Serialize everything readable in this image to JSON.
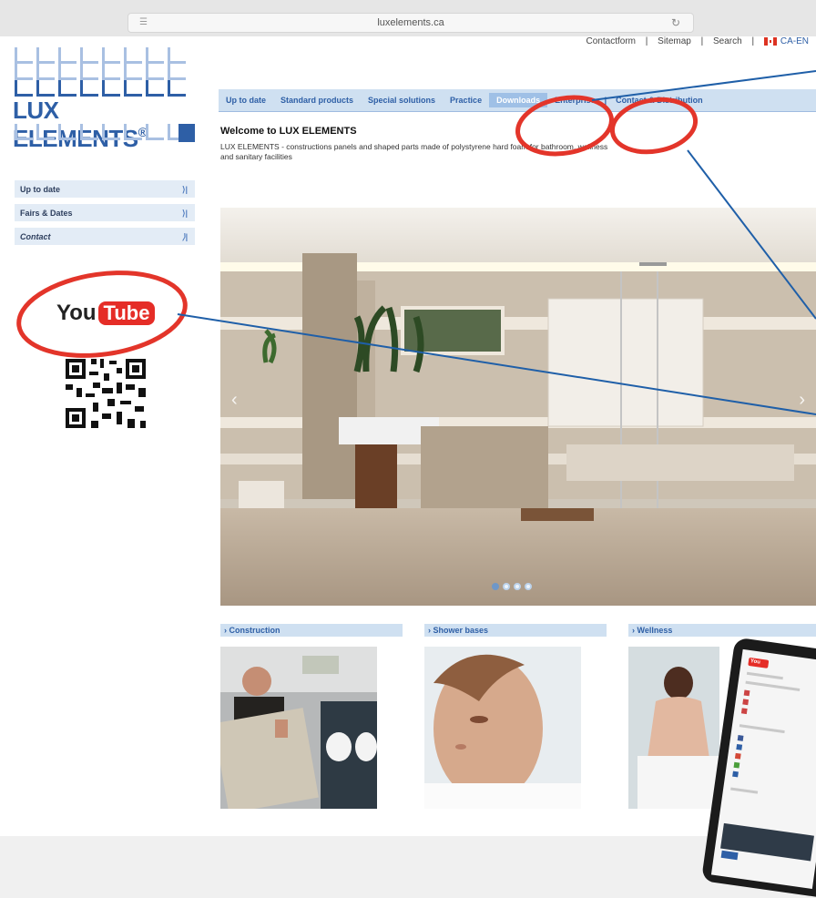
{
  "browser": {
    "url": "luxelements.ca",
    "reader_icon": "reader-icon",
    "reload_icon": "reload-icon"
  },
  "logo": {
    "text": "LUX ELEMENTS",
    "registered": "®"
  },
  "toplinks": {
    "contactform": "Contactform",
    "sitemap": "Sitemap",
    "search": "Search",
    "separator": "|",
    "locale": "CA-EN",
    "flag_icon": "canada-flag-icon"
  },
  "mainnav": {
    "items": [
      "Up to date",
      "Standard products",
      "Special solutions",
      "Practice",
      "Downloads",
      "Enterprise",
      "Contact & Distribution"
    ],
    "separator": "|"
  },
  "sidebar": {
    "items": [
      {
        "label": "Up to date",
        "chevron": "⟩|"
      },
      {
        "label": "Fairs & Dates",
        "chevron": "⟩|"
      },
      {
        "label": "Contact",
        "chevron": "⟩|"
      }
    ]
  },
  "youtube": {
    "you": "You",
    "tube": "Tube"
  },
  "content": {
    "welcome": "Welcome to LUX ELEMENTS",
    "intro": "LUX ELEMENTS - constructions panels and shaped parts made of polystyrene hard foam for bathroom, wellness and sanitary facilities",
    "slider_active": 1,
    "slider_count": 4,
    "prev_arrow": "‹",
    "next_arrow": "›"
  },
  "categories": [
    {
      "label": "› Construction"
    },
    {
      "label": "› Shower bases"
    },
    {
      "label": "› Wellness"
    }
  ],
  "tablet": {
    "yt_label": "You"
  },
  "colors": {
    "brand_blue": "#2e5fa6",
    "nav_bg": "#cfe0f1",
    "annotation_red": "#e3352a",
    "callout_blue": "#1f5fa8"
  }
}
